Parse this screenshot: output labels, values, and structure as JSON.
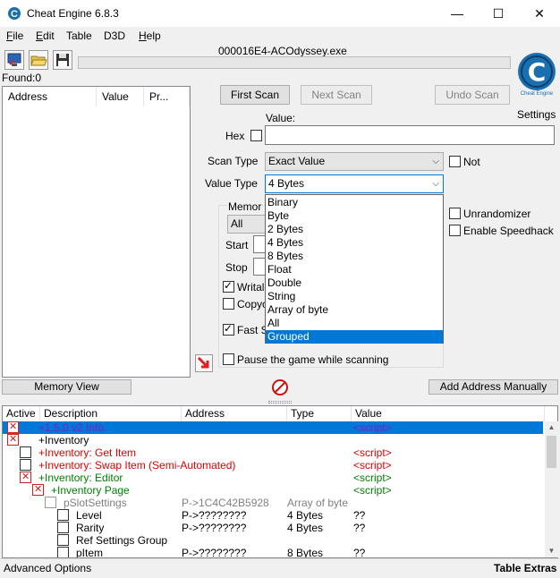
{
  "window": {
    "title": "Cheat Engine 6.8.3",
    "minimize": "—",
    "maximize": "☐",
    "close": "✕"
  },
  "menu": [
    {
      "label": "File",
      "u": "F",
      "rest": "ile"
    },
    {
      "label": "Edit",
      "u": "E",
      "rest": "dit"
    },
    {
      "label": "Table",
      "u": "",
      "rest": "Table"
    },
    {
      "label": "D3D",
      "u": "",
      "rest": "D3D"
    },
    {
      "label": "Help",
      "u": "H",
      "rest": "elp"
    }
  ],
  "process": "000016E4-ACOdyssey.exe",
  "found": "Found:0",
  "found_list": {
    "columns": [
      "Address",
      "Value",
      "Pr..."
    ]
  },
  "scan": {
    "first_scan": "First Scan",
    "next_scan": "Next Scan",
    "undo_scan": "Undo Scan",
    "value_label": "Value:",
    "hex_label": "Hex",
    "scan_type_label": "Scan Type",
    "scan_type_value": "Exact Value",
    "not_label": "Not",
    "value_type_label": "Value Type",
    "value_type_value": "4 Bytes",
    "memory_label": "Memor",
    "memory_region": "All",
    "start_label": "Start",
    "stop_label": "Stop",
    "writable_label": "Writal",
    "copy_label": "Copyo",
    "fast_label": "Fast S",
    "unrandomizer": "Unrandomizer",
    "speedhack": "Enable Speedhack",
    "pause": "Pause the game while scanning"
  },
  "value_type_options": [
    "Binary",
    "Byte",
    "2 Bytes",
    "4 Bytes",
    "8 Bytes",
    "Float",
    "Double",
    "String",
    "Array of byte",
    "All",
    "Grouped"
  ],
  "settings_label": "Settings",
  "logo_text": "Cheat Engine",
  "memory_view": "Memory View",
  "add_address": "Add Address Manually",
  "table": {
    "columns": [
      "Active",
      "Description",
      "Address",
      "Type",
      "Value"
    ],
    "rows": [
      {
        "desc": "+1.5.0 v2 Info",
        "address": "",
        "type": "",
        "value": "<script>"
      },
      {
        "desc": "+Inventory",
        "address": "",
        "type": "",
        "value": ""
      },
      {
        "desc": "+Inventory: Get Item",
        "address": "",
        "type": "",
        "value": "<script>"
      },
      {
        "desc": "+Inventory: Swap Item (Semi-Automated)",
        "address": "",
        "type": "",
        "value": "<script>"
      },
      {
        "desc": "+Inventory: Editor",
        "address": "",
        "type": "",
        "value": "<script>"
      },
      {
        "desc": "+Inventory Page",
        "address": "",
        "type": "",
        "value": "<script>"
      },
      {
        "desc": "pSlotSettings",
        "address": "P->1C4C42B5928",
        "type": "Array of byte",
        "value": ""
      },
      {
        "desc": "Level",
        "address": "P->????????",
        "type": "4 Bytes",
        "value": "??"
      },
      {
        "desc": "Rarity",
        "address": "P->????????",
        "type": "4 Bytes",
        "value": "??"
      },
      {
        "desc": "Ref Settings Group",
        "address": "",
        "type": "",
        "value": ""
      },
      {
        "desc": "pItem",
        "address": "P->????????",
        "type": "8 Bytes",
        "value": "??"
      }
    ]
  },
  "status": {
    "advanced": "Advanced Options",
    "extras": "Table Extras"
  },
  "colors": {
    "selection": "#0078d7",
    "script_red": "#e00000",
    "group_green": "#008000",
    "gray_text": "#808080",
    "purple": "#8020c0"
  }
}
